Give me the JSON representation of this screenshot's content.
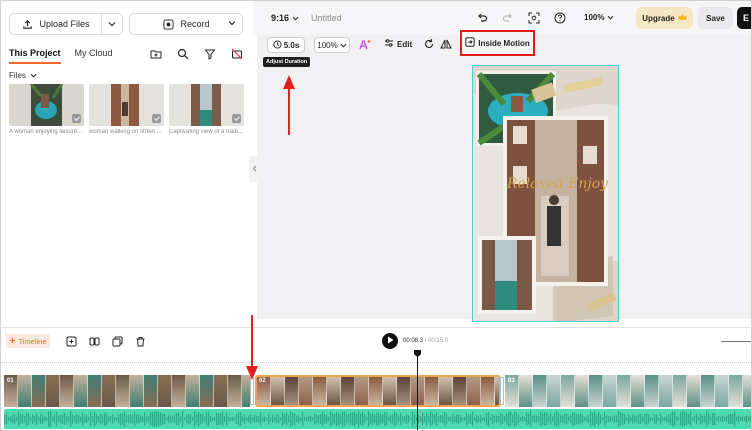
{
  "left_panel": {
    "upload_label": "Upload Files",
    "record_label": "Record",
    "tabs": [
      {
        "label": "This Project",
        "active": true
      },
      {
        "label": "My Cloud",
        "active": false
      }
    ],
    "files_label": "Files",
    "media": [
      {
        "caption": "A woman enjoying leisure..."
      },
      {
        "caption": "woman walking on street ..."
      },
      {
        "caption": "Captivating view of a tradi..."
      }
    ]
  },
  "top_bar": {
    "aspect_ratio": "9:16",
    "project_title": "Untitled",
    "zoom": "100%",
    "upgrade_label": "Upgrade",
    "save_label": "Save",
    "export_label": "E"
  },
  "canvas_toolbar": {
    "duration": "5.0s",
    "duration_tooltip": "Adjust Duration",
    "zoom": "100%",
    "edit_label": "Edit",
    "inside_motion_label": "Inside Motion"
  },
  "preview": {
    "overlay_text": "Relaxed Enjoy"
  },
  "timeline": {
    "tab_label": "Timeline",
    "current_time": "00:08.3",
    "separator": " / ",
    "total_time": "00:15.0",
    "clips": [
      {
        "number": "01"
      },
      {
        "number": "02"
      },
      {
        "number": "03"
      }
    ]
  },
  "colors": {
    "accent": "#f06a2a",
    "highlight_box": "#e21b1b",
    "selected_clip_border": "#f0a24c",
    "audio_track": "#4fd9b1"
  }
}
